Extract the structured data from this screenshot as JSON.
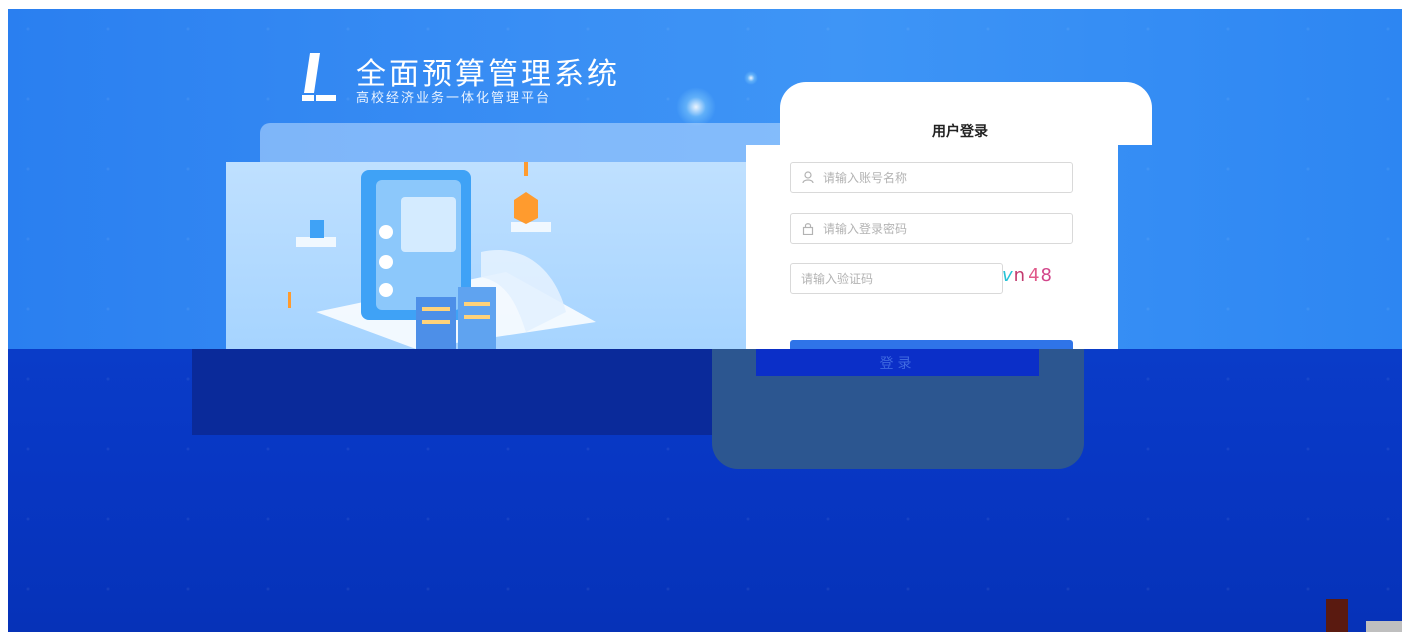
{
  "header": {
    "title": "全面预算管理系统",
    "subtitle": "高校经济业务一体化管理平台"
  },
  "login": {
    "title": "用户登录",
    "username_placeholder": "请输入账号名称",
    "password_placeholder": "请输入登录密码",
    "captcha_placeholder": "请输入验证码",
    "captcha_chars": [
      "v",
      "n",
      "4",
      "8"
    ],
    "submit_label": "登录"
  },
  "icons": {
    "logo": "logo-icon",
    "user": "user-icon",
    "lock": "lock-icon"
  },
  "colors": {
    "primary": "#2f74e8",
    "background": "#3a8ff4",
    "band_dark": "#0837c4",
    "captcha": [
      "#27c3d6",
      "#c23a6e",
      "#e05a8a",
      "#d2458a"
    ]
  }
}
